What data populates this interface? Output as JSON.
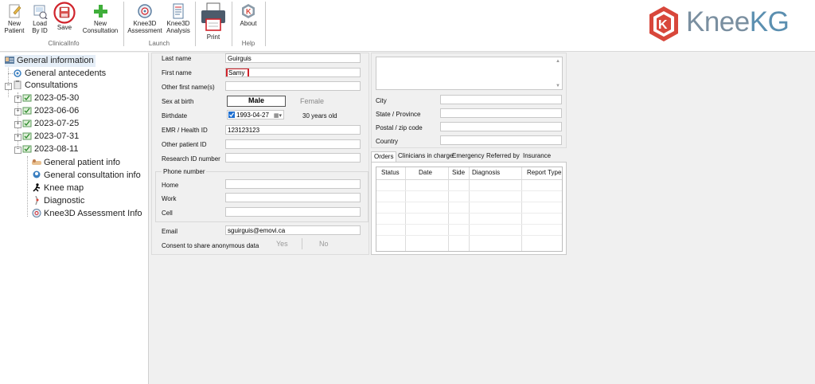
{
  "ribbon": {
    "new_patient": "New\nPatient",
    "load_by_id": "Load\nBy ID",
    "save": "Save",
    "new_consultation": "New\nConsultation",
    "clinicalinfo_group": "ClinicalInfo",
    "knee3d_assessment": "Knee3D\nAssessment",
    "knee3d_analysis": "Knee3D\nAnalysis",
    "launch_group": "Launch",
    "print": "Print",
    "about": "About",
    "help_group": "Help"
  },
  "brand": {
    "name_part1": "Knee",
    "name_part2": "KG",
    "accent": "#5b8fb0",
    "logo_red": "#d8473b"
  },
  "tree": {
    "general_information": "General information",
    "general_antecedents": "General antecedents",
    "consultations": "Consultations",
    "dates": [
      "2023-05-30",
      "2023-06-06",
      "2023-07-25",
      "2023-07-31",
      "2023-08-11"
    ],
    "children": [
      "General patient info",
      "General consultation info",
      "Knee map",
      "Diagnostic",
      "Knee3D Assessment Info"
    ]
  },
  "form": {
    "last_name_label": "Last name",
    "last_name_value": "Guirguis",
    "first_name_label": "First name",
    "first_name_value": "Samy",
    "other_first_names_label": "Other first name(s)",
    "sex_label": "Sex at birth",
    "sex_male": "Male",
    "sex_female": "Female",
    "birthdate_label": "Birthdate",
    "birthdate_value": "1993-04-27",
    "age_text": "30 years old",
    "emr_label": "EMR / Health ID",
    "emr_value": "123123123",
    "other_patient_id_label": "Other patient ID",
    "research_id_label": "Research ID number",
    "phone_group": "Phone number",
    "home_label": "Home",
    "work_label": "Work",
    "cell_label": "Cell",
    "email_label": "Email",
    "email_value": "sguirguis@emovi.ca",
    "consent_label": "Consent to share anonymous data",
    "consent_yes": "Yes",
    "consent_no": "No"
  },
  "address": {
    "city_label": "City",
    "state_label": "State / Province",
    "postal_label": "Postal / zip code",
    "country_label": "Country"
  },
  "orders": {
    "tabs": [
      "Orders",
      "Clinicians in charge",
      "Emergency",
      "Referred by",
      "Insurance"
    ],
    "columns": [
      "Status",
      "Date",
      "Side",
      "Diagnosis",
      "Report Type"
    ]
  }
}
